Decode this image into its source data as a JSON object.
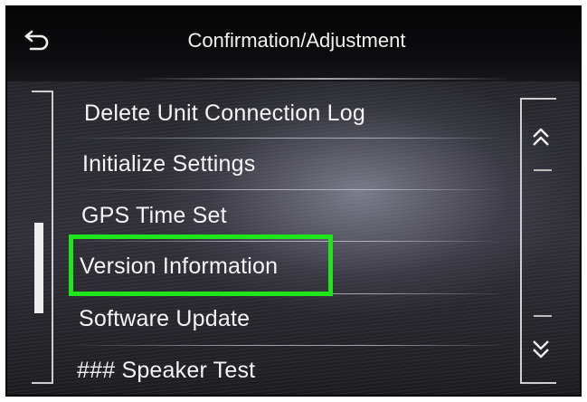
{
  "header": {
    "title": "Confirmation/Adjustment",
    "back_icon": "back-arrow-icon"
  },
  "menu": {
    "items": [
      {
        "label": "Delete Unit Connection Log"
      },
      {
        "label": "Initialize Settings"
      },
      {
        "label": "GPS Time Set"
      },
      {
        "label": "Version Information",
        "highlighted": true
      },
      {
        "label": "Software Update"
      },
      {
        "label": "### Speaker Test"
      }
    ]
  },
  "scroll": {
    "up_icon": "double-chevron-up-icon",
    "down_icon": "double-chevron-down-icon"
  },
  "colors": {
    "highlight": "#1fe61a",
    "text": "#f5f5f5",
    "background": "#0b0b0c"
  }
}
